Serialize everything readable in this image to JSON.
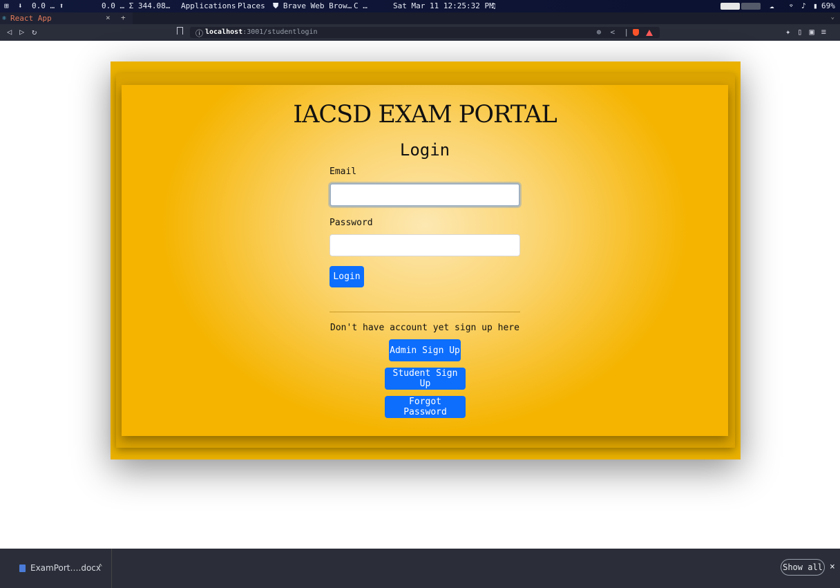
{
  "system_bar": {
    "workspace_icon": "grid-icon",
    "net_down": "0.0 … ⬆",
    "net_up": "0.0 … Σ 344.08…",
    "menu_applications": "Applications",
    "menu_places": "Places",
    "app_label": "Brave Web Brow…",
    "loader": "C …",
    "datetime": "Sat Mar 11 12:25:32 PM",
    "battery_percent": "69%"
  },
  "browser": {
    "tab_title": "React App",
    "tab_close": "×",
    "new_tab": "+",
    "url_host": "localhost",
    "url_rest": ":3001/studentlogin"
  },
  "page": {
    "portal_title": "IACSD EXAM PORTAL",
    "login_heading": "Login",
    "email_label": "Email",
    "email_value": "",
    "password_label": "Password",
    "password_value": "",
    "login_button": "Login",
    "signup_prompt": "Don't have account yet sign up here",
    "admin_signup_button": "Admin Sign Up",
    "student_signup_button": "Student Sign Up",
    "forgot_password_button": "Forgot Password"
  },
  "downloads": {
    "file_name": "ExamPort….docx",
    "show_all": "Show all",
    "close": "×"
  },
  "colors": {
    "accent_button": "#0d6efd",
    "card_gold": "#f5b400"
  }
}
